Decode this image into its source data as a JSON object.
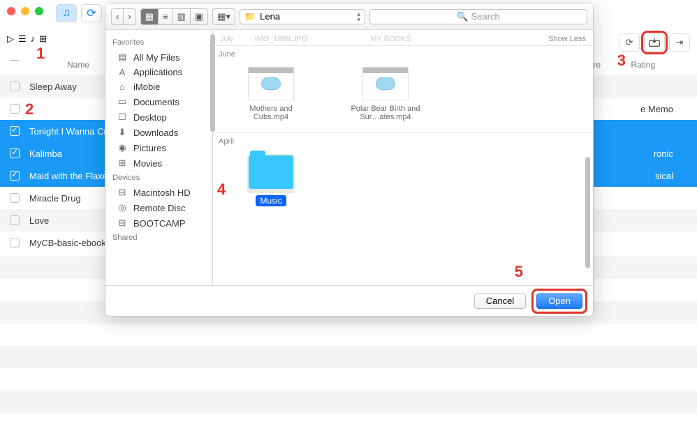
{
  "window": {
    "folder_label": "Lena",
    "search_placeholder": "Search"
  },
  "columns": {
    "name": "Name",
    "re": "re",
    "rating": "Rating"
  },
  "songs": [
    {
      "name": "Sleep Away",
      "selected": false,
      "extra": ""
    },
    {
      "name": " ",
      "selected": false,
      "extra": "e Memo"
    },
    {
      "name": "Tonight I Wanna Cry",
      "selected": true,
      "extra": ""
    },
    {
      "name": "Kalimba",
      "selected": true,
      "extra": "ronic"
    },
    {
      "name": "Maid with the Flaxen",
      "selected": true,
      "extra": "sical"
    },
    {
      "name": "Miracle Drug",
      "selected": false,
      "extra": ""
    },
    {
      "name": "Love",
      "selected": false,
      "extra": ""
    },
    {
      "name": "MyCB-basic-ebook",
      "selected": false,
      "extra": ""
    }
  ],
  "sidebar": {
    "favorites_label": "Favorites",
    "favorites": [
      "All My Files",
      "Applications",
      "iMobie",
      "Documents",
      "Desktop",
      "Downloads",
      "Pictures",
      "Movies"
    ],
    "favorites_icons": [
      "▤",
      "A",
      "⌂",
      "▭",
      "☐",
      "⬇",
      "◉",
      "⊞"
    ],
    "devices_label": "Devices",
    "devices": [
      "Macintosh HD",
      "Remote Disc",
      "BOOTCAMP"
    ],
    "devices_icons": [
      "⊟",
      "◎",
      "⊟"
    ],
    "shared_label": "Shared"
  },
  "browse": {
    "ghost_a": "IMG_1989.JPG",
    "ghost_b": "MY BOOKS",
    "showless": "Show Less",
    "july": "July",
    "june": "June",
    "april": "April",
    "files_june": [
      {
        "label": "Mothers and Cubs.mp4"
      },
      {
        "label": "Polar Bear Birth and Sur…ates.mp4"
      }
    ],
    "music_label": "Music"
  },
  "footer": {
    "cancel": "Cancel",
    "open": "Open"
  },
  "callouts": {
    "c1": "1",
    "c2": "2",
    "c3": "3",
    "c4": "4",
    "c5": "5"
  }
}
